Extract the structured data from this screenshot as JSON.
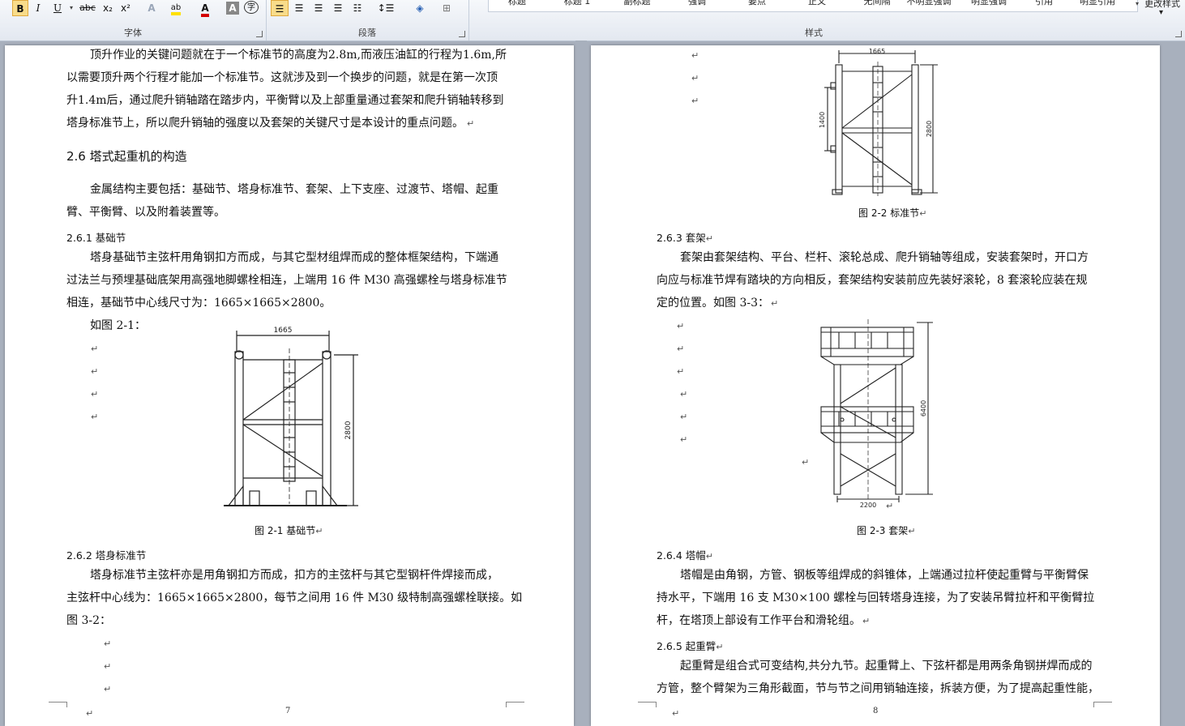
{
  "ribbon": {
    "groups": {
      "font": "字体",
      "paragraph": "段落",
      "styles": "样式"
    },
    "font_buttons": [
      {
        "name": "bold-button",
        "label": "B"
      },
      {
        "name": "italic-button",
        "label": "I"
      },
      {
        "name": "underline-button",
        "label": "U"
      },
      {
        "name": "strikethrough-button",
        "label": "abc"
      },
      {
        "name": "subscript-button",
        "label": "x₂"
      },
      {
        "name": "superscript-button",
        "label": "x²"
      }
    ],
    "styles": [
      "标题",
      "标题 1",
      "副标题",
      "强调",
      "要点",
      "正文",
      "无间隔",
      "不明显强调",
      "明显强调",
      "引用",
      "明显引用"
    ],
    "change_styles": "更改样式"
  },
  "page7": {
    "para1": [
      "顶升作业的关键问题就在于一个标准节的高度为2.8m,而液压油缸的行程为1.6m,所",
      "以需要顶升两个行程才能加一个标准节。这就涉及到一个换步的问题，就是在第一次顶",
      "升1.4m后，通过爬升销轴踏在踏步内，平衡臂以及上部重量通过套架和爬升销轴转移到",
      "塔身标准节上，所以爬升销轴的强度以及套架的关键尺寸是本设计的重点问题。"
    ],
    "h26": "2.6 塔式起重机的构造",
    "para2": [
      "金属结构主要包括：基础节、塔身标准节、套架、上下支座、过渡节、塔帽、起重",
      "臂、平衡臂、以及附着装置等。"
    ],
    "h261": "2.6.1 基础节",
    "para3": [
      "塔身基础节主弦杆用角钢扣方而成，与其它型材组焊而成的整体框架结构，下端通",
      "过法兰与预埋基础底架用高强地脚螺栓相连，上端用 16 件 M30 高强螺栓与塔身标准节",
      "相连，基础节中心线尺寸为：1665×1665×2800。"
    ],
    "see_fig": "如图 2-1：",
    "fig1_width": "1665",
    "fig1_height": "2800",
    "fig1_caption": "图 2-1  基础节",
    "h262": "2.6.2 塔身标准节",
    "para4": [
      "塔身标准节主弦杆亦是用角钢扣方而成，扣方的主弦杆与其它型钢杆件焊接而成，",
      "主弦杆中心线为：1665×1665×2800，每节之间用 16 件 M30 级特制高强螺栓联接。如",
      "图 3-2："
    ],
    "page_number": "7"
  },
  "page8": {
    "fig2_width": "1665",
    "fig2_height": "2800",
    "fig2_step": "1400",
    "fig2_caption": "图 2-2  标准节",
    "h263": "2.6.3 套架",
    "para1": [
      "套架由套架结构、平台、栏杆、滚轮总成、爬升销轴等组成，安装套架时，开口方",
      "向应与标准节焊有踏块的方向相反，套架结构安装前应先装好滚轮，8 套滚轮应装在规",
      "定的位置。如图 3-3："
    ],
    "fig3_height": "6400",
    "fig3_width": "2200",
    "fig3_caption": "图 2-3  套架",
    "h264": "2.6.4 塔帽",
    "para2": [
      "塔帽是由角钢，方管、钢板等组焊成的斜锥体，上端通过拉杆使起重臂与平衡臂保",
      "持水平，下端用 16 支 M30×100 螺栓与回转塔身连接，为了安装吊臂拉杆和平衡臂拉",
      "杆，在塔顶上部设有工作平台和滑轮组。"
    ],
    "h265": "2.6.5 起重臂",
    "para3": [
      "起重臂是组合式可变结构,共分九节。起重臂上、下弦杆都是用两条角钢拼焊而成的",
      "方管，整个臂架为三角形截面，节与节之间用销轴连接，拆装方便，为了提高起重性能，"
    ],
    "page_number": "8"
  },
  "marks": {
    "para": "↵"
  }
}
